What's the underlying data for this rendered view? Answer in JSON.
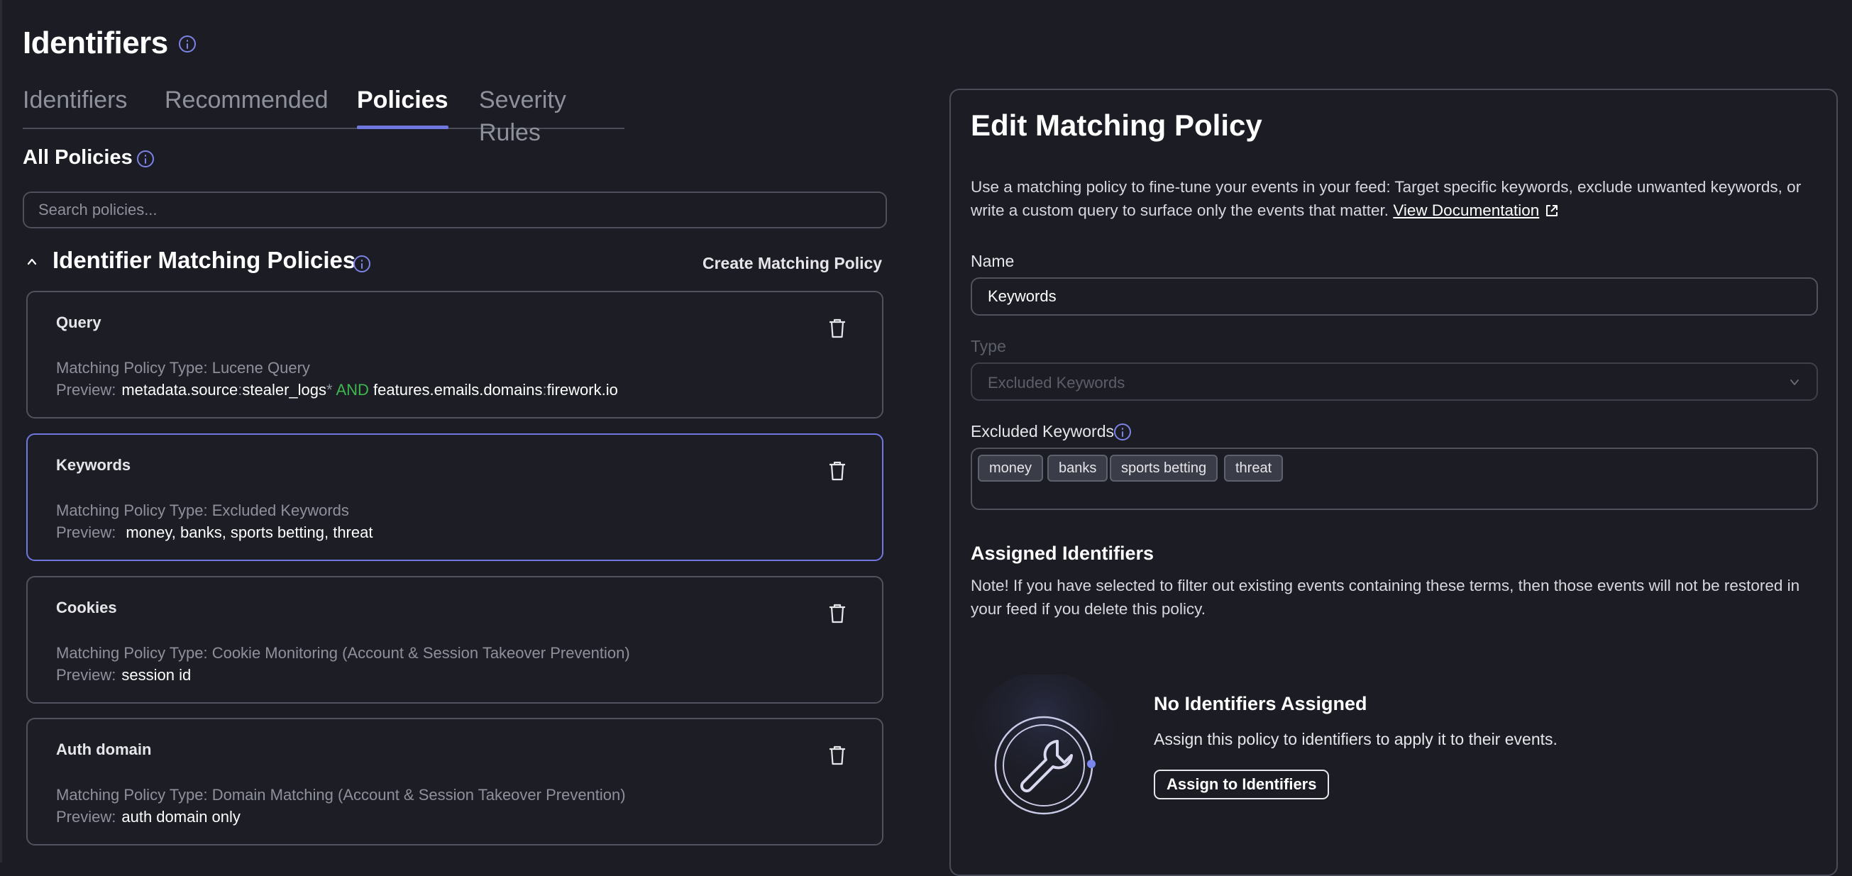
{
  "header": {
    "title": "Identifiers",
    "info_icon": "info-icon"
  },
  "tabs": [
    {
      "label": "Identifiers",
      "active": false
    },
    {
      "label": "Recommended",
      "active": false
    },
    {
      "label": "Policies",
      "active": true
    },
    {
      "label": "Severity Rules",
      "active": false
    }
  ],
  "policies": {
    "section_title": "All Policies",
    "search_placeholder": "Search policies...",
    "group_title": "Identifier Matching Policies",
    "create_label": "Create Matching Policy",
    "type_prefix": "Matching Policy Type: ",
    "preview_label": "Preview:",
    "items": [
      {
        "name": "Query",
        "type": "Lucene Query",
        "preview_parts": [
          "metadata.source",
          ":",
          "stealer_logs",
          "*",
          " AND ",
          "features.emails.domains",
          ":",
          "firework.io"
        ]
      },
      {
        "name": "Keywords",
        "type": "Excluded Keywords",
        "preview": "money, banks, sports betting, threat",
        "selected": true
      },
      {
        "name": "Cookies",
        "type": "Cookie Monitoring (Account & Session Takeover Prevention)",
        "preview": "session id"
      },
      {
        "name": "Auth domain",
        "type": "Domain Matching (Account & Session Takeover Prevention)",
        "preview": "auth domain only"
      }
    ]
  },
  "edit_panel": {
    "title": "Edit Matching Policy",
    "description": "Use a matching policy to fine-tune your events in your feed: Target specific keywords, exclude unwanted keywords, or write a custom query to surface only the events that matter.",
    "doc_link": "View Documentation",
    "name_label": "Name",
    "name_value": "Keywords",
    "type_label": "Type",
    "type_value": "Excluded Keywords",
    "keywords_label": "Excluded Keywords",
    "keywords": [
      "money",
      "banks",
      "sports betting",
      "threat"
    ],
    "assigned_title": "Assigned Identifiers",
    "assigned_note": "Note! If you have selected to filter out existing events containing these terms, then those events will not be restored in your feed if you delete this policy.",
    "empty_title": "No Identifiers Assigned",
    "empty_desc": "Assign this policy to identifiers to apply it to their events.",
    "assign_button": "Assign to Identifiers"
  },
  "colors": {
    "background": "#1b1c24",
    "accent": "#7078e0",
    "query_and": "#3fb64e",
    "muted_text": "#8e909b"
  }
}
